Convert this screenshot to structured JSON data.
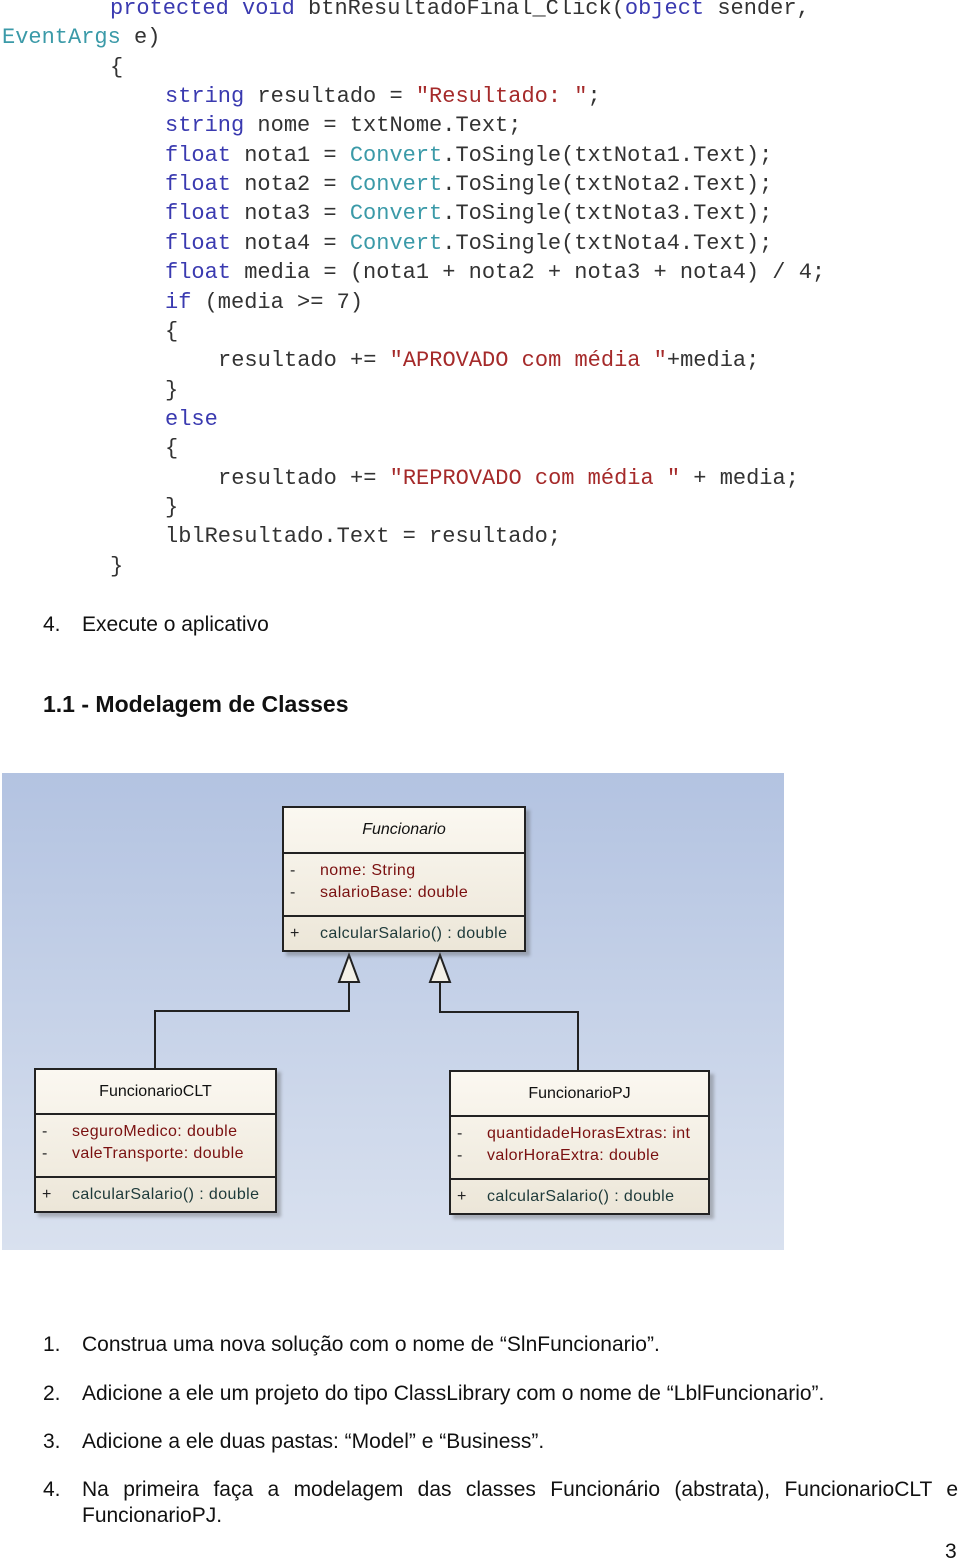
{
  "code": {
    "lines": [
      {
        "indent": 110,
        "tokens": [
          [
            "kw",
            "protected"
          ],
          [
            "pl",
            " "
          ],
          [
            "kw",
            "void"
          ],
          [
            "pl",
            " btnResultadoFinal_Click("
          ],
          [
            "kw",
            "object"
          ],
          [
            "pl",
            " sender,"
          ]
        ]
      },
      {
        "indent": 2,
        "tokens": [
          [
            "ty",
            "EventArgs"
          ],
          [
            "pl",
            " e)"
          ]
        ]
      },
      {
        "indent": 110,
        "tokens": [
          [
            "pl",
            "{"
          ]
        ]
      },
      {
        "indent": 165,
        "tokens": [
          [
            "kw",
            "string"
          ],
          [
            "pl",
            " resultado = "
          ],
          [
            "st",
            "\"Resultado: \""
          ],
          [
            "pl",
            ";"
          ]
        ]
      },
      {
        "indent": 165,
        "tokens": [
          [
            "kw",
            "string"
          ],
          [
            "pl",
            " nome = txtNome.Text;"
          ]
        ]
      },
      {
        "indent": 165,
        "tokens": [
          [
            "kw",
            "float"
          ],
          [
            "pl",
            " nota1 = "
          ],
          [
            "ty",
            "Convert"
          ],
          [
            "pl",
            ".ToSingle(txtNota1.Text);"
          ]
        ]
      },
      {
        "indent": 165,
        "tokens": [
          [
            "kw",
            "float"
          ],
          [
            "pl",
            " nota2 = "
          ],
          [
            "ty",
            "Convert"
          ],
          [
            "pl",
            ".ToSingle(txtNota2.Text);"
          ]
        ]
      },
      {
        "indent": 165,
        "tokens": [
          [
            "kw",
            "float"
          ],
          [
            "pl",
            " nota3 = "
          ],
          [
            "ty",
            "Convert"
          ],
          [
            "pl",
            ".ToSingle(txtNota3.Text);"
          ]
        ]
      },
      {
        "indent": 165,
        "tokens": [
          [
            "kw",
            "float"
          ],
          [
            "pl",
            " nota4 = "
          ],
          [
            "ty",
            "Convert"
          ],
          [
            "pl",
            ".ToSingle(txtNota4.Text);"
          ]
        ]
      },
      {
        "indent": 165,
        "tokens": [
          [
            "kw",
            "float"
          ],
          [
            "pl",
            " media = (nota1 + nota2 + nota3 + nota4) / 4;"
          ]
        ]
      },
      {
        "indent": 165,
        "tokens": [
          [
            "kw",
            "if"
          ],
          [
            "pl",
            " (media >= 7)"
          ]
        ]
      },
      {
        "indent": 165,
        "tokens": [
          [
            "pl",
            "{"
          ]
        ]
      },
      {
        "indent": 218,
        "tokens": [
          [
            "pl",
            "resultado += "
          ],
          [
            "st",
            "\"APROVADO com média \""
          ],
          [
            "pl",
            "+media;"
          ]
        ]
      },
      {
        "indent": 165,
        "tokens": [
          [
            "pl",
            "}"
          ]
        ]
      },
      {
        "indent": 165,
        "tokens": [
          [
            "kw",
            "else"
          ]
        ]
      },
      {
        "indent": 165,
        "tokens": [
          [
            "pl",
            "{"
          ]
        ]
      },
      {
        "indent": 218,
        "tokens": [
          [
            "pl",
            "resultado += "
          ],
          [
            "st",
            "\"REPROVADO com média \""
          ],
          [
            "pl",
            " + media;"
          ]
        ]
      },
      {
        "indent": 165,
        "tokens": [
          [
            "pl",
            "}"
          ]
        ]
      },
      {
        "indent": 165,
        "tokens": [
          [
            "pl",
            "lblResultado.Text = resultado;"
          ]
        ]
      },
      {
        "indent": 110,
        "tokens": [
          [
            "pl",
            "}"
          ]
        ]
      }
    ]
  },
  "step_execute": {
    "number": "4.",
    "text": "Execute o aplicativo"
  },
  "section_heading": "1.1 - Modelagem de Classes",
  "diagram": {
    "classes": [
      {
        "name": "Funcionario",
        "abstract": true,
        "attributes": [
          {
            "vis": "-",
            "text": "nome:  String"
          },
          {
            "vis": "-",
            "text": "salarioBase:  double"
          }
        ],
        "methods": [
          {
            "vis": "+",
            "text": "calcularSalario() : double"
          }
        ]
      },
      {
        "name": "FuncionarioCLT",
        "abstract": false,
        "attributes": [
          {
            "vis": "-",
            "text": "seguroMedico:  double"
          },
          {
            "vis": "-",
            "text": "valeTransporte:  double"
          }
        ],
        "methods": [
          {
            "vis": "+",
            "text": "calcularSalario() : double"
          }
        ]
      },
      {
        "name": "FuncionarioPJ",
        "abstract": false,
        "attributes": [
          {
            "vis": "-",
            "text": "quantidadeHorasExtras:  int"
          },
          {
            "vis": "-",
            "text": "valorHoraExtra:  double"
          }
        ],
        "methods": [
          {
            "vis": "+",
            "text": "calcularSalario() : double"
          }
        ]
      }
    ],
    "relations": [
      {
        "type": "generalization",
        "from": "FuncionarioCLT",
        "to": "Funcionario"
      },
      {
        "type": "generalization",
        "from": "FuncionarioPJ",
        "to": "Funcionario"
      }
    ]
  },
  "steps": [
    {
      "number": "1.",
      "text": "Construa uma nova solução com o nome de “SlnFuncionario”."
    },
    {
      "number": "2.",
      "text": "Adicione a ele um projeto do tipo ClassLibrary com o nome de “LblFuncionario”."
    },
    {
      "number": "3.",
      "text": "Adicione a ele duas pastas: “Model” e “Business”."
    },
    {
      "number": "4.",
      "text": "Na primeira faça a modelagem das classes Funcionário (abstrata), FuncionarioCLT e FuncionarioPJ."
    }
  ],
  "page_number": "3"
}
